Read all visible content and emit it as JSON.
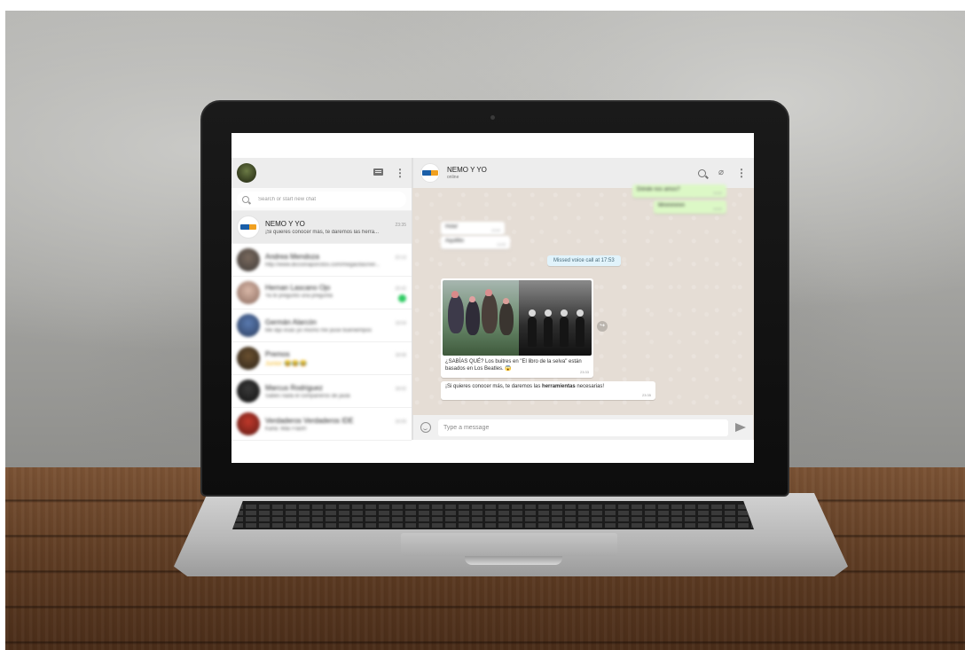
{
  "sidebar": {
    "search_placeholder": "Search or start new chat",
    "chats": [
      {
        "name": "NEMO Y YO",
        "time": "23:35",
        "preview": "¡Si quieres conocer más, te daremos las herra..."
      },
      {
        "name": "Andrea Mendoza",
        "time": "22:13",
        "preview": "http://www.diccionaporcitos.com/megacitas/ver..."
      },
      {
        "name": "Hernan Lascano Ojo",
        "time": "20:32",
        "preview": "Ya te pregunto una pregunta"
      },
      {
        "name": "Germán Alarcón",
        "time": "19:04",
        "preview": "Me dijo esas yo mismo me puse bueniempos"
      },
      {
        "name": "Premos",
        "time": "18:58",
        "preview": "Junior 😂😂😂"
      },
      {
        "name": "Marcus Rodriguez",
        "time": "18:02",
        "preview": "Sabes nada el compañeros de jaula"
      },
      {
        "name": "Verdaderos Verdaderos IDE",
        "time": "16:59",
        "preview": "Karla: Más Flash!"
      }
    ]
  },
  "conversation": {
    "title": "NEMO Y YO",
    "status": "online",
    "blurred_out_1": "Dónde nos amos?",
    "blurred_out_1_time": "14:02",
    "blurred_out_2": "Mmmmmm",
    "blurred_out_2_time": "14:02",
    "blurred_in_1": "Hola!",
    "blurred_in_1_time": "14:04",
    "blurred_in_2": "Aquillito",
    "blurred_in_2_time": "14:05",
    "system_note": "Missed voice call at 17:53",
    "image_caption": "¿SABÍAS QUÉ? Los buitres en \"El libro de la selva\" están basados en Los Beatles. 😱",
    "image_time": "23:33",
    "last_msg_prefix": "¡Si quieres conocer más, te daremos las ",
    "last_msg_bold": "herramientas",
    "last_msg_suffix": " necesarias!",
    "last_msg_time": "23:35",
    "composer_placeholder": "Type a message"
  },
  "icons": {
    "new_chat": "chat-icon",
    "menu": "more-vertical-icon",
    "search": "search-icon",
    "attach": "paperclip-icon",
    "emoji": "smiley-icon",
    "send": "send-icon",
    "forward": "forward-icon"
  },
  "colors": {
    "header_bg": "#ededed",
    "conversation_bg": "#e5ddd5",
    "outgoing_bubble": "#dcf8c6",
    "system_bubble": "#e1f3fb",
    "unread_badge": "#2fcb63"
  }
}
